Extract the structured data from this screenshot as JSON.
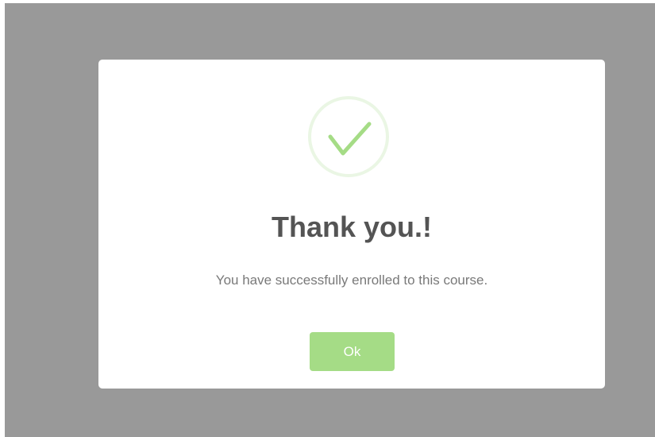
{
  "dialog": {
    "icon": "checkmark-success-icon",
    "title": "Thank you.!",
    "message": "You have successfully enrolled to this course.",
    "confirm_label": "Ok"
  },
  "colors": {
    "overlay": "#999999",
    "success_green": "#a5dc86",
    "ring": "#eaf6e4",
    "title_text": "#545454",
    "message_text": "#797979"
  }
}
